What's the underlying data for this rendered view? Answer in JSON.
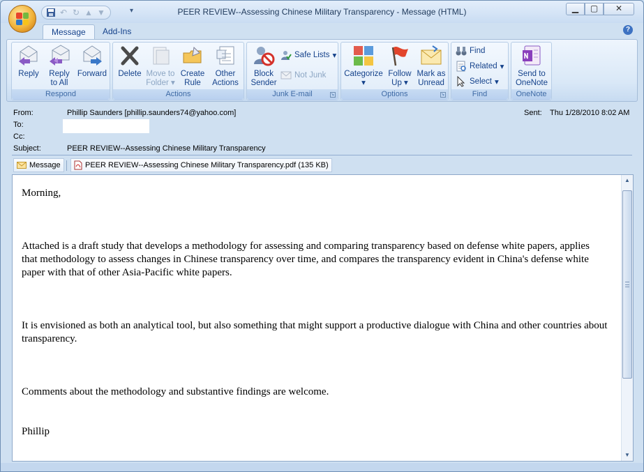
{
  "window": {
    "title": "PEER REVIEW--Assessing Chinese Military Transparency - Message (HTML)",
    "controls": {
      "minimize": "▁",
      "maximize": "▢",
      "close": "✕"
    }
  },
  "quick_access": {
    "more": "▾"
  },
  "tabs": [
    {
      "label": "Message",
      "active": true
    },
    {
      "label": "Add-Ins",
      "active": false
    }
  ],
  "ribbon": {
    "respond": {
      "label": "Respond",
      "reply": "Reply",
      "reply_all_1": "Reply",
      "reply_all_2": "to All",
      "forward": "Forward"
    },
    "actions": {
      "label": "Actions",
      "delete": "Delete",
      "move_1": "Move to",
      "move_2": "Folder",
      "create_1": "Create",
      "create_2": "Rule",
      "other_1": "Other",
      "other_2": "Actions"
    },
    "junk": {
      "label": "Junk E-mail",
      "block_1": "Block",
      "block_2": "Sender",
      "safe_lists": "Safe Lists",
      "not_junk": "Not Junk"
    },
    "options": {
      "label": "Options",
      "categorize": "Categorize",
      "follow_1": "Follow",
      "follow_2": "Up",
      "mark_1": "Mark as",
      "mark_2": "Unread"
    },
    "find": {
      "label": "Find",
      "find": "Find",
      "related": "Related",
      "select": "Select"
    },
    "onenote": {
      "label": "OneNote",
      "send_1": "Send to",
      "send_2": "OneNote"
    }
  },
  "header": {
    "from_label": "From:",
    "from": "Phillip Saunders [phillip.saunders74@yahoo.com]",
    "to_label": "To:",
    "cc_label": "Cc:",
    "subject_label": "Subject:",
    "subject": "PEER REVIEW--Assessing Chinese Military Transparency",
    "sent_label": "Sent:",
    "sent": "Thu 1/28/2010 8:02 AM"
  },
  "attachments": {
    "message_tab": "Message",
    "file": "PEER REVIEW--Assessing Chinese Military Transparency.pdf (135 KB)"
  },
  "body": {
    "p1": "Morning,",
    "p2": "Attached is a draft study that develops a methodology for assessing and comparing transparency based on defense white papers, applies that methodology to assess changes in Chinese transparency over time, and compares the transparency evident in China's defense white paper with that of other Asia-Pacific white papers.",
    "p3": "It is envisioned as both an analytical tool, but also something that might support a productive dialogue with China and other countries about transparency.",
    "p4": "Comments about the methodology and substantive findings are welcome.",
    "p5": "Phillip"
  },
  "colors": {
    "ribbon_text": "#15428b",
    "group_label": "#3e6aa5",
    "accent_blue": "#3d72c2"
  }
}
